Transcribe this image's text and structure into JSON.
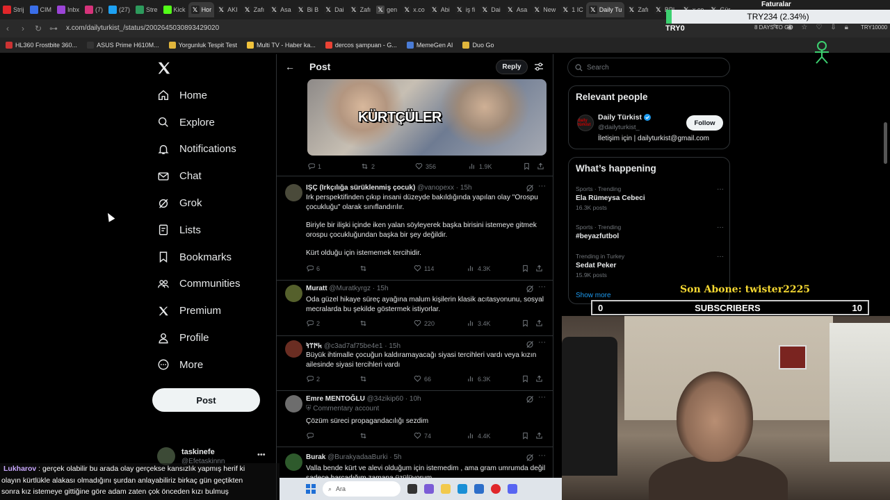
{
  "browser": {
    "tabs": [
      "Strij",
      "CIM",
      "Inbx",
      "(7)",
      "(27)",
      "Stre",
      "Kick",
      "Hor",
      "AKI",
      "Zafı",
      "Asa",
      "Bi B",
      "Dai",
      "Zafı",
      "gen",
      "x.co",
      "Abi",
      "iş fi",
      "Dai",
      "Asa",
      "New",
      "1 IC",
      "Daily Tu",
      "Zafı",
      "BPL",
      "x.co",
      "Gür"
    ],
    "url": "x.com/dailyturkist_/status/2002645030893429020",
    "bookmarks": [
      "HL360 Frostbite 360...",
      "ASUS Prime H610M...",
      "Yorgunluk Tespit Test",
      "Multi TV - Haber ka...",
      "dercos şampuan - G...",
      "MemeGen AI",
      "Duo Go"
    ]
  },
  "overlay": {
    "ticker": "TRY234 (2.34%)",
    "faturalar": "Faturalar",
    "try_zero": "TRY0",
    "days_to_go": "8 DAYS TO GO",
    "try_right": "TRY10000",
    "son_abone": "Son Abone: twister2225",
    "subs_left": "0",
    "subs_label": "SUBSCRIBERS",
    "subs_right": "10"
  },
  "sidebar": {
    "items": [
      {
        "label": "Home",
        "icon": "home-icon"
      },
      {
        "label": "Explore",
        "icon": "search-icon"
      },
      {
        "label": "Notifications",
        "icon": "bell-icon"
      },
      {
        "label": "Chat",
        "icon": "mail-icon"
      },
      {
        "label": "Grok",
        "icon": "grok-icon"
      },
      {
        "label": "Lists",
        "icon": "lists-icon"
      },
      {
        "label": "Bookmarks",
        "icon": "bookmark-icon"
      },
      {
        "label": "Communities",
        "icon": "communities-icon"
      },
      {
        "label": "Premium",
        "icon": "x-icon"
      },
      {
        "label": "Profile",
        "icon": "person-icon"
      },
      {
        "label": "More",
        "icon": "more-circle-icon"
      }
    ],
    "post_label": "Post",
    "account": {
      "name": "taskinefe",
      "handle": "@Efetaskinnn"
    }
  },
  "main": {
    "title": "Post",
    "reply_label": "Reply",
    "image_caption": "KÜRTÇÜLER",
    "post_stats": {
      "replies": "1",
      "reposts": "2",
      "likes": "356",
      "views": "1.9K"
    },
    "replies": [
      {
        "name": "IŞÇ (Irkçılığa sürüklenmiş çocuk)",
        "handle": "@vanopexx",
        "time": "15h",
        "body": [
          "Irk perspektifinden çıkıp insani düzeyde bakıldığında yapılan olay \"Orospu çocukluğu\" olarak sınıflandırılır.",
          "Biriyle bir ilişki içinde iken yalan söyleyerek başka birisini istemeye gitmek orospu çocukluğundan başka bir şey değildir.",
          "Kürt olduğu için istememek tercihidir."
        ],
        "stats": {
          "replies": "6",
          "reposts": "",
          "likes": "114",
          "views": "4.3K"
        }
      },
      {
        "name": "Muratt",
        "handle": "@Muratkyrgz",
        "time": "15h",
        "body": [
          "Oda güzel hikaye süreç ayağına malum kişilerin klasik acıtasyonunu, sosyal mecralarda bu şekilde göstermek istiyorlar."
        ],
        "stats": {
          "replies": "2",
          "reposts": "",
          "likes": "220",
          "views": "3.4K"
        }
      },
      {
        "name": "𐱅𐰇𐰼𐰚",
        "handle": "@c3ad7af75be4e1",
        "time": "15h",
        "body": [
          "Büyük ihtimalle çocuğun kaldıramayacağı siyasi tercihleri vardı veya kızın ailesinde siyasi tercihleri vardı"
        ],
        "stats": {
          "replies": "2",
          "reposts": "",
          "likes": "66",
          "views": "6.3K"
        }
      },
      {
        "name": "Emre MENTOĞLU",
        "handle": "@34zikip60",
        "time": "10h",
        "sub": "Commentary account",
        "body": [
          "Çözüm süreci propagandacılığı sezdim"
        ],
        "stats": {
          "replies": "",
          "reposts": "",
          "likes": "74",
          "views": "4.4K"
        }
      },
      {
        "name": "Burak",
        "handle": "@BurakyadaaBurki",
        "time": "5h",
        "body": [
          "Valla bende kürt ve alevi olduğum için istemedim , ama gram umrumda değil sadece harcadığım zamana üzülüyorum"
        ],
        "stats": {
          "replies": "",
          "reposts": "",
          "likes": "",
          "views": ""
        }
      }
    ]
  },
  "right": {
    "search_placeholder": "Search",
    "relevant_title": "Relevant people",
    "person": {
      "name": "Daily Türkist",
      "handle": "@dailyturkist_",
      "bio": "İletişim için | dailyturkist@gmail.com",
      "follow_label": "Follow",
      "avatar_text": "daily türkist"
    },
    "happening_title": "What’s happening",
    "trends": [
      {
        "context": "Sports · Trending",
        "title": "Ela Rümeysa Cebeci",
        "posts": "16.3K posts"
      },
      {
        "context": "Sports · Trending",
        "title": "#beyazfutbol",
        "posts": ""
      },
      {
        "context": "Trending in Turkey",
        "title": "Sedat Peker",
        "posts": "15.9K posts"
      }
    ],
    "show_more": "Show more"
  },
  "chat": {
    "user": "Lukharov",
    "lines": [
      " : gerçek olabilir bu arada olay gerçekse kansızlık yapmış herif ki",
      "olayın kürtlükle alakası olmadığını şurdan anlayabiliriz birkaç gün geçtikten",
      "sonra kız istemeye gittiğine göre adam zaten çok önceden kızı bulmuş"
    ]
  },
  "taskbar": {
    "search_label": "Ara"
  },
  "colors": {
    "accent": "#1d9bf0",
    "bg": "#000000",
    "border": "#2f3336",
    "muted": "#71767b"
  }
}
